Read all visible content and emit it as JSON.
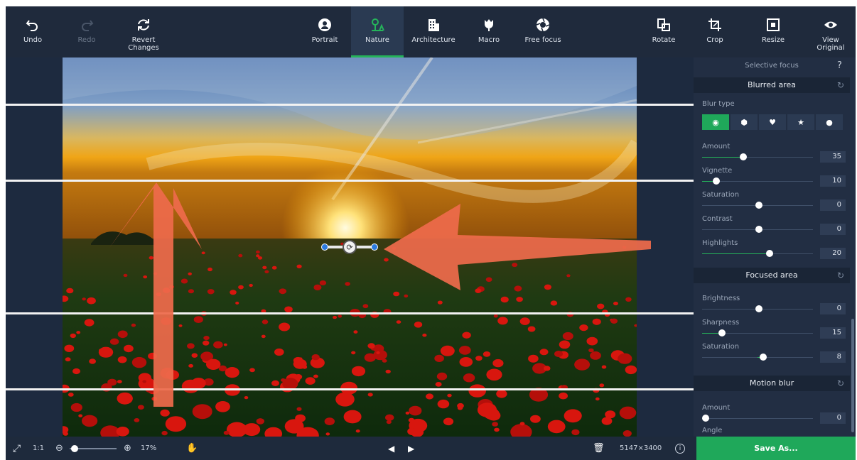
{
  "toolbar": {
    "undo": "Undo",
    "redo": "Redo",
    "revert": "Revert\nChanges",
    "portrait": "Portrait",
    "nature": "Nature",
    "architecture": "Architecture",
    "macro": "Macro",
    "free_focus": "Free focus",
    "rotate": "Rotate",
    "crop": "Crop",
    "resize": "Resize",
    "view_original": "View\nOriginal"
  },
  "panel": {
    "title": "Selective focus",
    "help": "?",
    "blurred_area": {
      "header": "Blurred area",
      "blur_type_label": "Blur type",
      "blur_types": [
        "circle",
        "hexagon",
        "heart",
        "star",
        "drop"
      ],
      "selected_blur_type": "circle",
      "sliders": [
        {
          "label": "Amount",
          "value": "35"
        },
        {
          "label": "Vignette",
          "value": "10"
        },
        {
          "label": "Saturation",
          "value": "0"
        },
        {
          "label": "Contrast",
          "value": "0"
        },
        {
          "label": "Highlights",
          "value": "20"
        }
      ]
    },
    "focused_area": {
      "header": "Focused area",
      "sliders": [
        {
          "label": "Brightness",
          "value": "0"
        },
        {
          "label": "Sharpness",
          "value": "15"
        },
        {
          "label": "Saturation",
          "value": "8"
        }
      ]
    },
    "motion_blur": {
      "header": "Motion blur",
      "sliders": [
        {
          "label": "Amount",
          "value": "0"
        },
        {
          "label": "Angle",
          "value": ""
        }
      ]
    }
  },
  "bottom": {
    "one_to_one": "1:1",
    "zoom_percent": "17%",
    "zoom_level": 0.1,
    "dimensions": "5147×3400",
    "save_as": "Save As..."
  },
  "colors": {
    "accent_green": "#25b35a",
    "arrow": "#ee6a4b",
    "background": "#1c2637"
  }
}
